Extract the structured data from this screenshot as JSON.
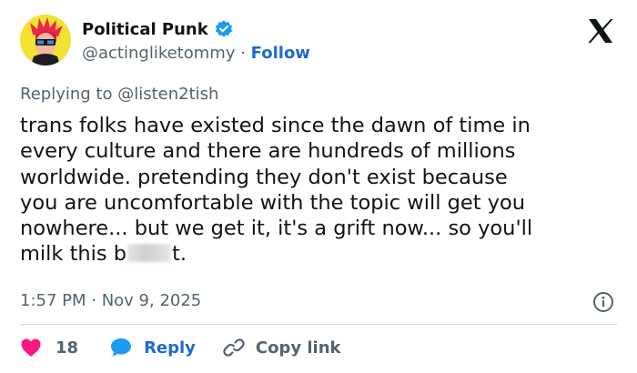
{
  "author": {
    "display_name": "Political Punk",
    "handle": "@actingliketommy",
    "separator": "·",
    "follow_label": "Follow",
    "verified": true
  },
  "tweet": {
    "replying_prefix": "Replying to",
    "replying_to": "@listen2tish",
    "text_before_censor": "trans folks have existed since the dawn of time in\nevery culture and there are hundreds of millions\nworldwide. pretending they don't exist because\nyou are uncomfortable with the topic will get you\nnowhere... but we get it, it's a grift now... so you'll\nmilk this b",
    "text_after_censor": "t.",
    "timestamp": "1:57 PM · Nov 9, 2025"
  },
  "actions": {
    "like_count": "18",
    "reply_label": "Reply",
    "copy_label": "Copy link"
  },
  "colors": {
    "accent": "#1d6bd0",
    "like": "#f91880",
    "muted": "#536471",
    "text": "#0f1419"
  },
  "icons": [
    "avatar",
    "verified-badge-icon",
    "x-logo-icon",
    "info-icon",
    "heart-icon",
    "reply-bubble-icon",
    "link-icon"
  ]
}
